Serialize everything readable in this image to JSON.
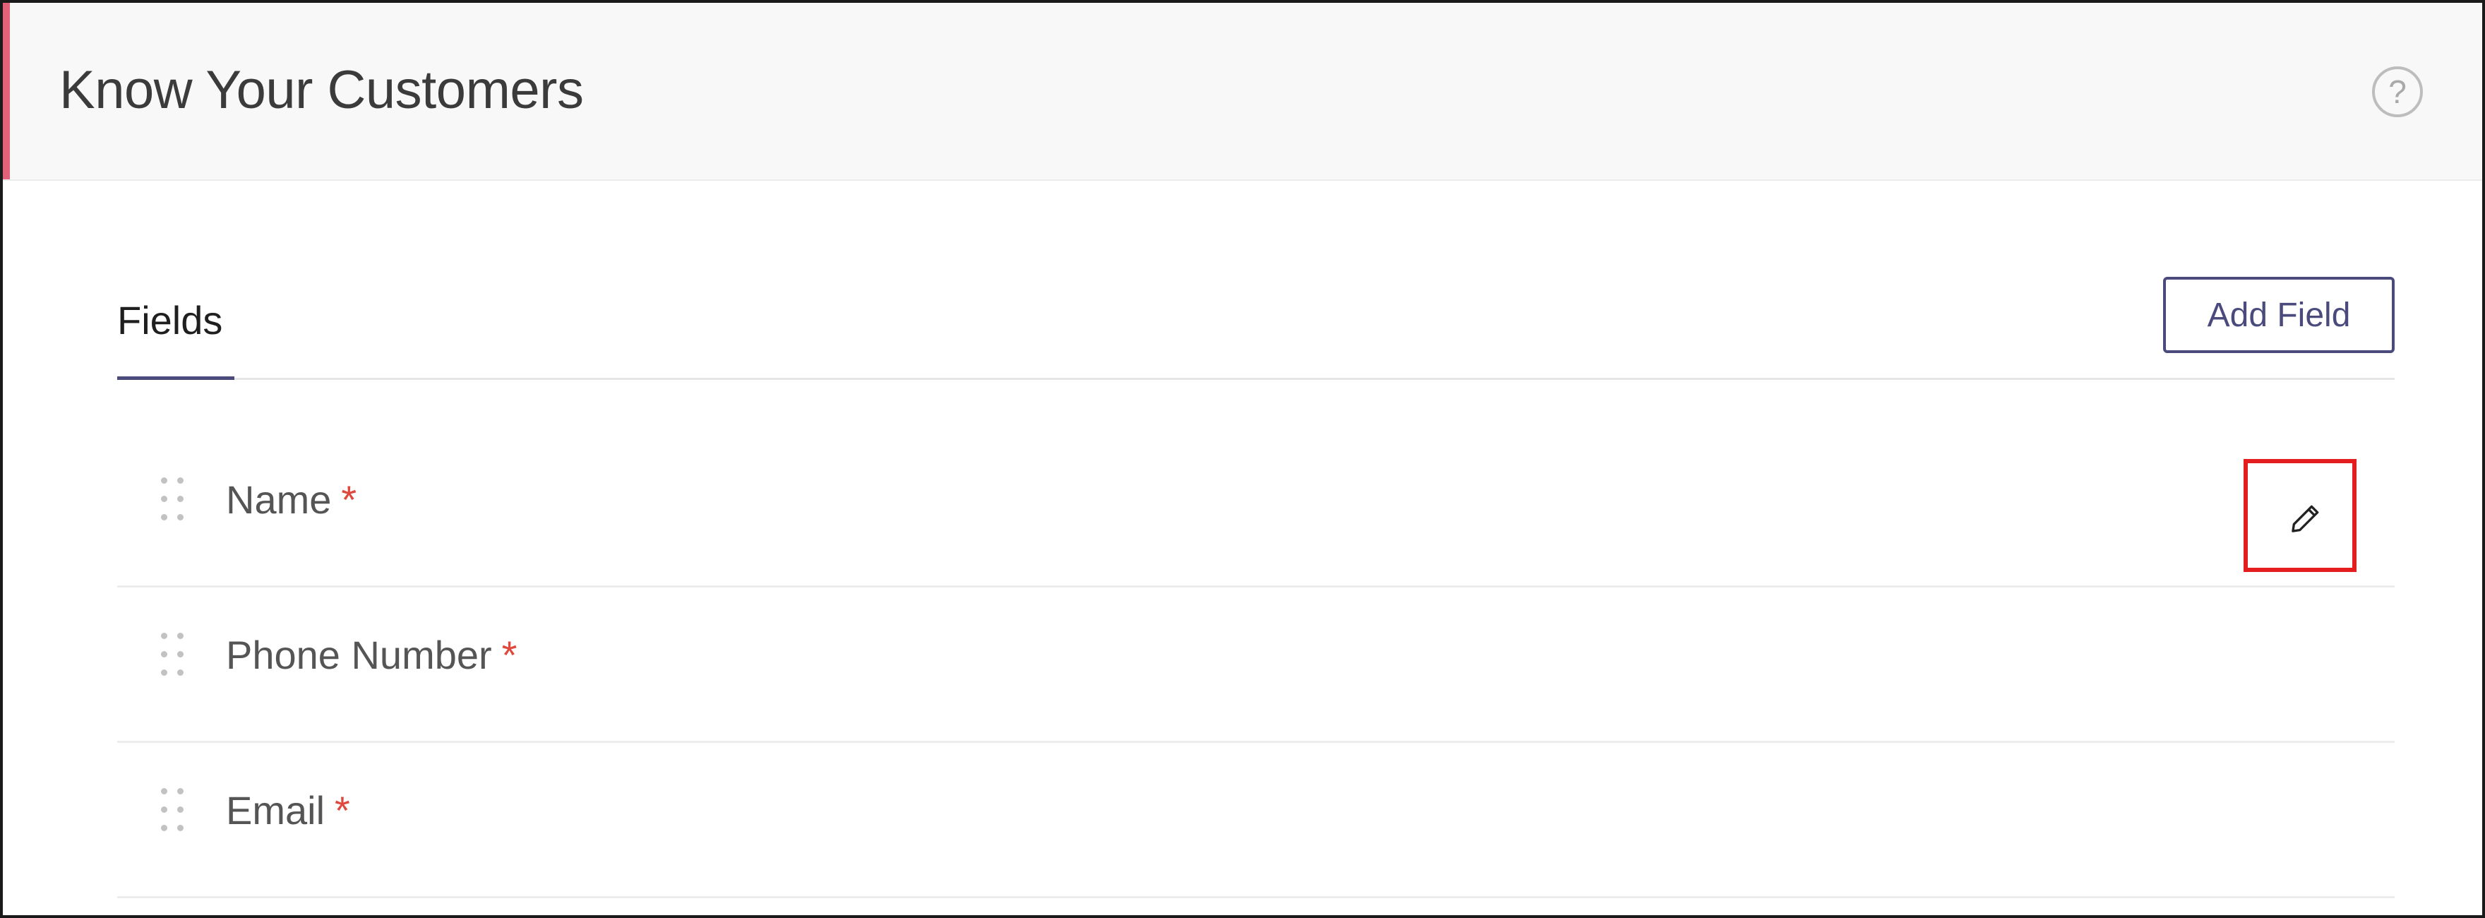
{
  "header": {
    "title": "Know Your Customers",
    "help_icon": "help-circle-icon",
    "help_glyph": "?"
  },
  "tabs": [
    {
      "label": "Fields",
      "active": true
    }
  ],
  "toolbar": {
    "add_field_label": "Add Field"
  },
  "fields": [
    {
      "label": "Name",
      "required_marker": "*",
      "edit_icon": "pencil-icon",
      "edit_highlighted": true
    },
    {
      "label": "Phone Number",
      "required_marker": "*"
    },
    {
      "label": "Email",
      "required_marker": "*"
    }
  ],
  "colors": {
    "accent": "#e2627a",
    "brand": "#4b4a7d",
    "required": "#e0483e",
    "highlight": "#e41e1e"
  }
}
